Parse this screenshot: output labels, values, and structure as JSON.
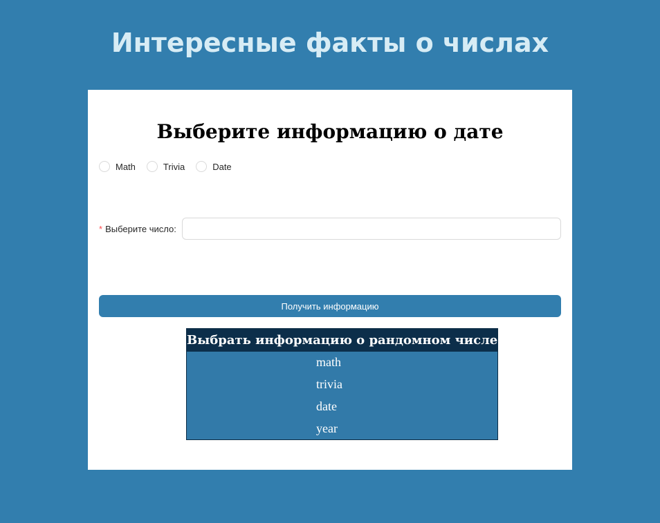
{
  "header": {
    "title": "Интересные факты о числах"
  },
  "card": {
    "heading": "Выберите информацию о дате",
    "radios": [
      {
        "label": "Math"
      },
      {
        "label": "Trivia"
      },
      {
        "label": "Date"
      }
    ],
    "number_field": {
      "required_mark": "*",
      "label": "Выберите число",
      "colon": ":",
      "value": ""
    },
    "submit_label": "Получить информацию"
  },
  "random_table": {
    "header": "Выбрать информацию о рандомном числе",
    "rows": [
      "math",
      "trivia",
      "date",
      "year"
    ]
  },
  "colors": {
    "background": "#327eae",
    "title": "#d7ecf5",
    "table_header": "#0c2e4a",
    "table_row": "#327aa9",
    "required": "#ff4d4f"
  }
}
